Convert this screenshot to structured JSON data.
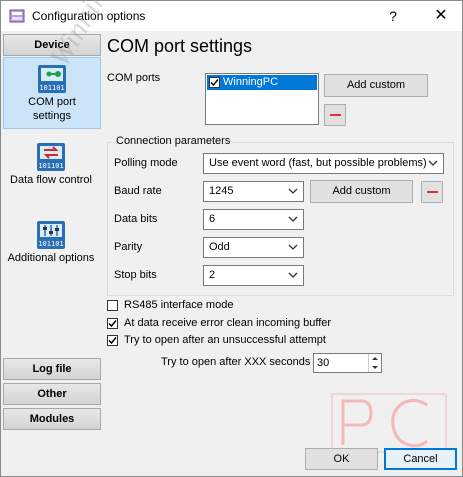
{
  "window": {
    "title": "Configuration options",
    "help_glyph": "?",
    "close_glyph": "✕",
    "watermark_text": "WinningPC"
  },
  "sidebar": {
    "device_label": "Device",
    "items": [
      {
        "label": "COM port settings",
        "icon": "com-port-icon",
        "selected": true
      },
      {
        "label": "Data flow control",
        "icon": "data-flow-icon",
        "selected": false
      },
      {
        "label": "Additional options",
        "icon": "additional-options-icon",
        "selected": false
      }
    ],
    "log_file_label": "Log file",
    "other_label": "Other",
    "modules_label": "Modules"
  },
  "main": {
    "page_title": "COM port settings",
    "com_ports_label": "COM ports",
    "com_ports_list": [
      {
        "name": "WinningPC",
        "checked": true
      }
    ],
    "add_custom_label": "Add custom",
    "connection_group_title": "Connection parameters",
    "polling_mode_label": "Polling mode",
    "polling_mode_value": "Use event word (fast, but possible problems)",
    "baud_rate_label": "Baud rate",
    "baud_rate_value": "1245",
    "baud_add_custom_label": "Add custom",
    "data_bits_label": "Data bits",
    "data_bits_value": "6",
    "parity_label": "Parity",
    "parity_value": "Odd",
    "stop_bits_label": "Stop bits",
    "stop_bits_value": "2",
    "rs485_label": "RS485 interface mode",
    "rs485_checked": false,
    "clean_buffer_label": "At data receive error clean incoming buffer",
    "clean_buffer_checked": true,
    "try_open_label": "Try to open after an unsuccessful attempt",
    "try_open_checked": true,
    "try_open_seconds_label": "Try to open after XXX seconds",
    "try_open_seconds_value": "30"
  },
  "footer": {
    "ok_label": "OK",
    "cancel_label": "Cancel"
  },
  "colors": {
    "selection_blue": "#0078d7",
    "sidebar_selected": "#cce4f7",
    "remove_red": "#e03030",
    "watermark_pink": "#f4b8b8"
  }
}
